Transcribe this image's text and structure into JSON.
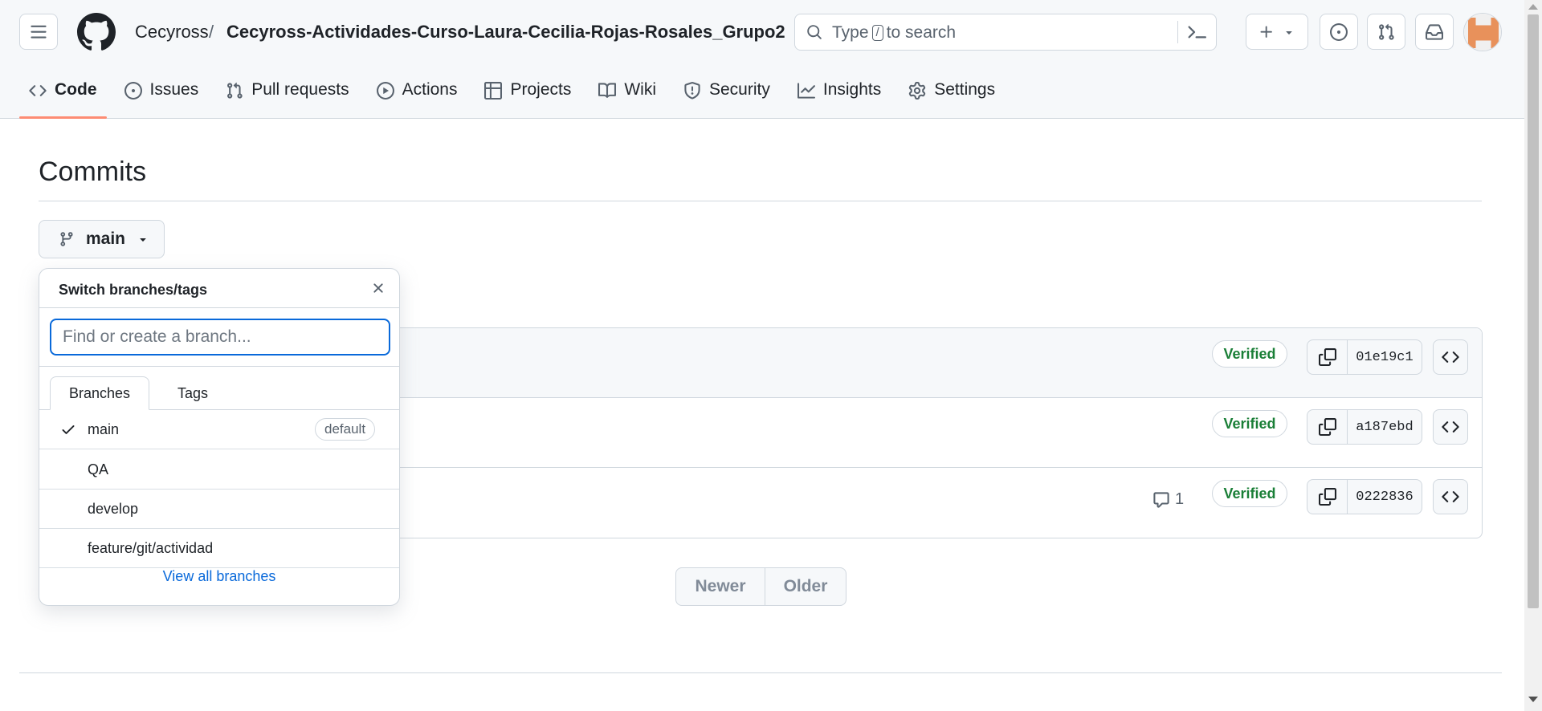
{
  "header": {
    "owner": "Cecyross",
    "separator": "/",
    "repo": "Cecyross-Actividades-Curso-Laura-Cecilia-Rojas-Rosales_Grupo2",
    "search": {
      "prefix": "Type",
      "key": "/",
      "suffix": "to search"
    }
  },
  "nav": {
    "tabs": [
      {
        "label": "Code",
        "icon": "code-icon",
        "active": true
      },
      {
        "label": "Issues",
        "icon": "issue-icon"
      },
      {
        "label": "Pull requests",
        "icon": "pull-request-icon"
      },
      {
        "label": "Actions",
        "icon": "play-icon"
      },
      {
        "label": "Projects",
        "icon": "table-icon"
      },
      {
        "label": "Wiki",
        "icon": "book-icon"
      },
      {
        "label": "Security",
        "icon": "shield-icon"
      },
      {
        "label": "Insights",
        "icon": "graph-icon"
      },
      {
        "label": "Settings",
        "icon": "gear-icon"
      }
    ]
  },
  "main": {
    "title": "Commits",
    "branch": "main",
    "commits": [
      {
        "status": "Verified",
        "sha": "01e19c1"
      },
      {
        "status": "Verified",
        "sha": "a187ebd"
      },
      {
        "status": "Verified",
        "sha": "0222836",
        "comments": "1"
      }
    ],
    "pagination": {
      "newer": "Newer",
      "older": "Older"
    }
  },
  "dropdown": {
    "title": "Switch branches/tags",
    "input_placeholder": "Find or create a branch...",
    "tabs": {
      "branches": "Branches",
      "tags": "Tags"
    },
    "branches": [
      {
        "name": "main",
        "selected": true,
        "badge": "default"
      },
      {
        "name": "QA"
      },
      {
        "name": "develop"
      },
      {
        "name": "feature/git/actividad"
      }
    ],
    "view_all": "View all branches"
  },
  "colors": {
    "accent_link": "#0969da",
    "verified": "#1a7f37",
    "active_tab_underline": "#fd8c73",
    "border": "#d0d7de"
  }
}
